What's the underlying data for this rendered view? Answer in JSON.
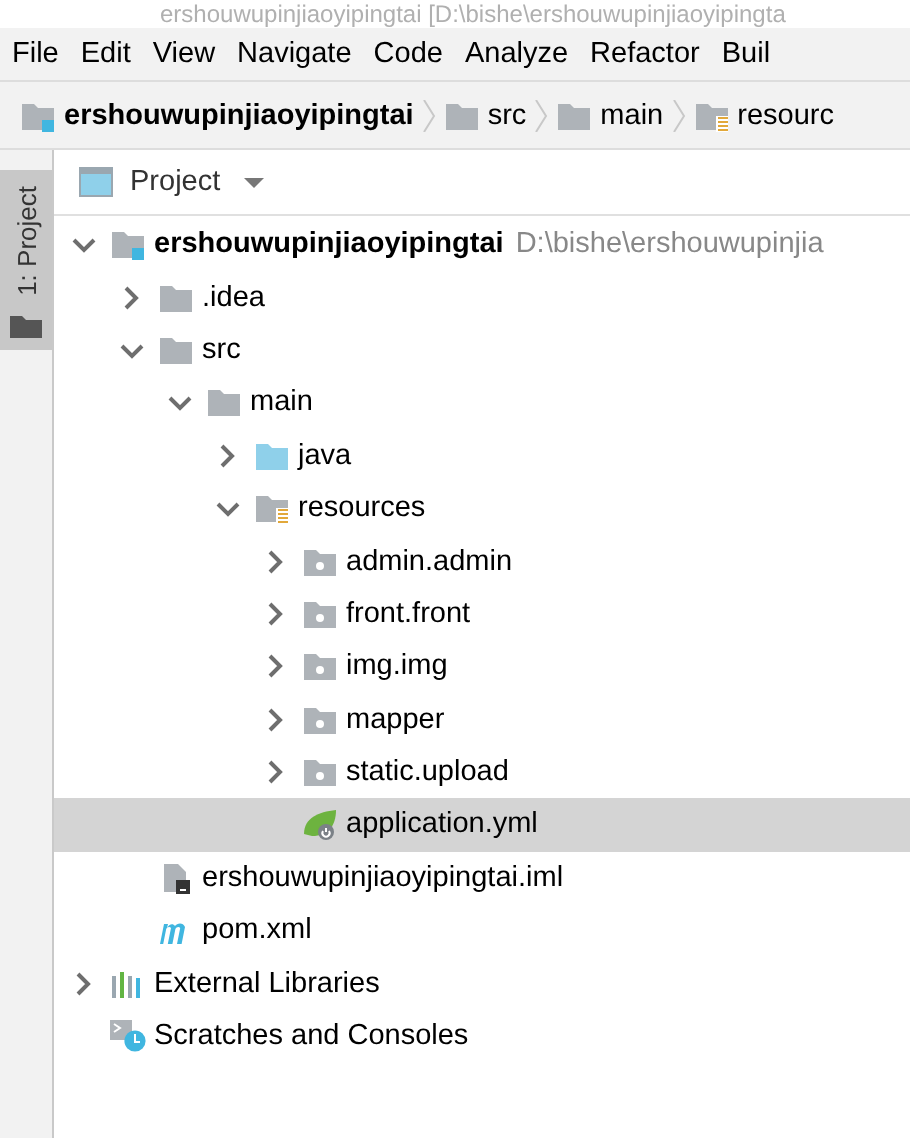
{
  "window": {
    "title": "ershouwupinjiaoyipingtai [D:\\bishe\\ershouwupinjiaoyipingta"
  },
  "menu": [
    "File",
    "Edit",
    "View",
    "Navigate",
    "Code",
    "Analyze",
    "Refactor",
    "Buil"
  ],
  "breadcrumbs": [
    {
      "label": "ershouwupinjiaoyipingtai",
      "kind": "module"
    },
    {
      "label": "src",
      "kind": "folder"
    },
    {
      "label": "main",
      "kind": "folder"
    },
    {
      "label": "resourc",
      "kind": "resources"
    }
  ],
  "side_tabs": [
    {
      "label": "1: Project",
      "selected": true
    }
  ],
  "panel": {
    "title": "Project"
  },
  "tree": [
    {
      "label": "ershouwupinjiaoyipingtai",
      "path": "D:\\bishe\\ershouwupinjia",
      "kind": "module",
      "expanded": true,
      "selected": false,
      "children": [
        {
          "label": ".idea",
          "kind": "folder",
          "expanded": false,
          "selected": false
        },
        {
          "label": "src",
          "kind": "folder",
          "expanded": true,
          "selected": false,
          "children": [
            {
              "label": "main",
              "kind": "folder",
              "expanded": true,
              "selected": false,
              "children": [
                {
                  "label": "java",
                  "kind": "source",
                  "expanded": false,
                  "selected": false
                },
                {
                  "label": "resources",
                  "kind": "resources",
                  "expanded": true,
                  "selected": false,
                  "children": [
                    {
                      "label": "admin.admin",
                      "kind": "package",
                      "expanded": false,
                      "selected": false
                    },
                    {
                      "label": "front.front",
                      "kind": "package",
                      "expanded": false,
                      "selected": false
                    },
                    {
                      "label": "img.img",
                      "kind": "package",
                      "expanded": false,
                      "selected": false
                    },
                    {
                      "label": "mapper",
                      "kind": "package",
                      "expanded": false,
                      "selected": false
                    },
                    {
                      "label": "static.upload",
                      "kind": "package",
                      "expanded": false,
                      "selected": false
                    },
                    {
                      "label": "application.yml",
                      "kind": "spring",
                      "selected": true
                    }
                  ]
                }
              ]
            }
          ]
        },
        {
          "label": "ershouwupinjiaoyipingtai.iml",
          "kind": "iml",
          "selected": false
        },
        {
          "label": "pom.xml",
          "kind": "maven",
          "selected": false
        }
      ]
    },
    {
      "label": "External Libraries",
      "kind": "libraries",
      "expanded": false,
      "selected": false
    },
    {
      "label": "Scratches and Consoles",
      "kind": "scratches",
      "selected": false
    }
  ]
}
